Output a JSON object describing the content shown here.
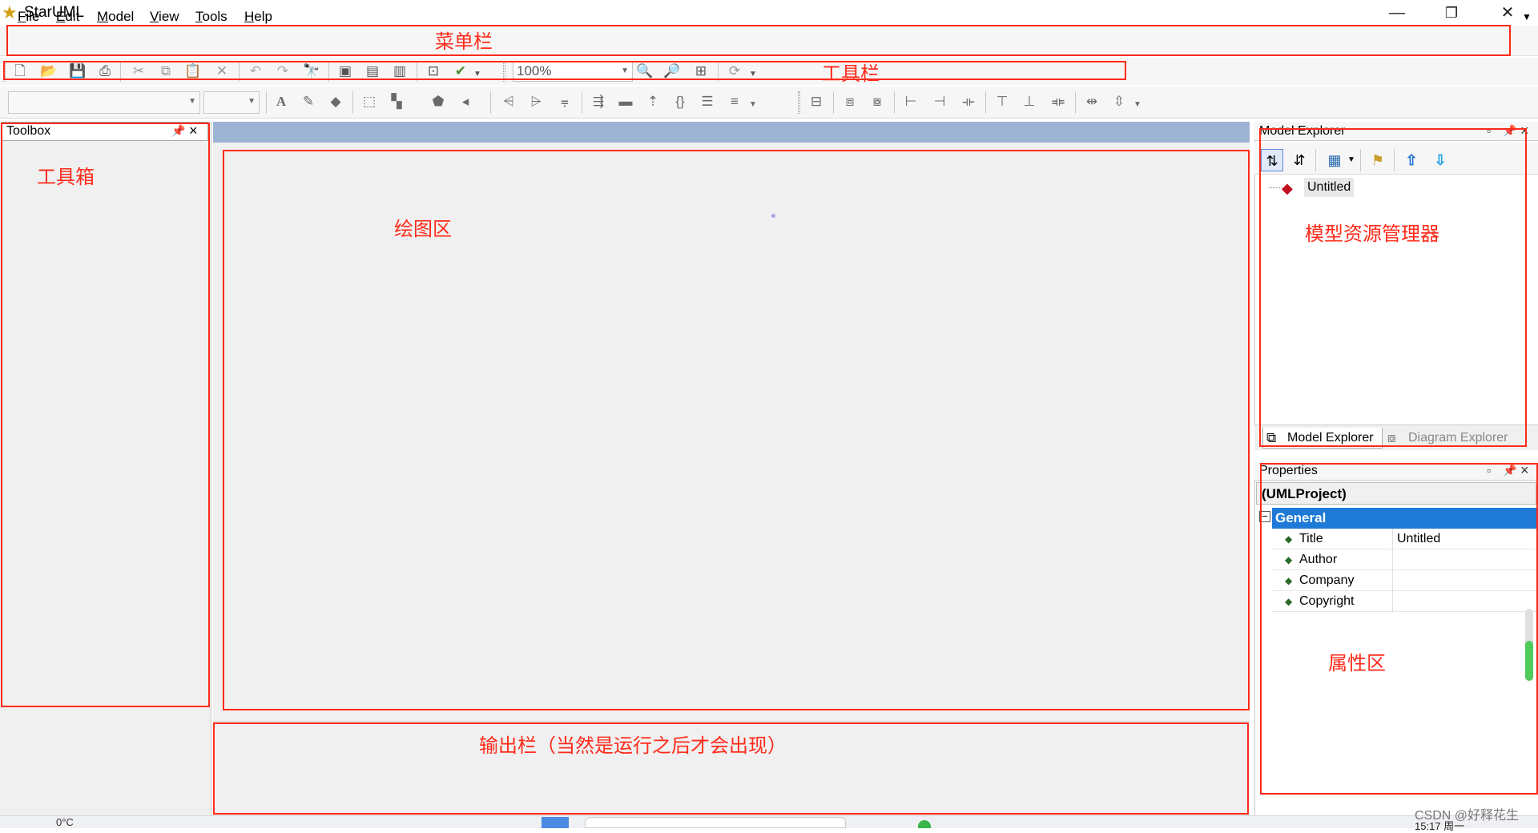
{
  "window": {
    "title": "StarUML"
  },
  "menu": [
    {
      "hot": "F",
      "rest": "ile"
    },
    {
      "hot": "E",
      "rest": "dit"
    },
    {
      "hot": "M",
      "rest": "odel"
    },
    {
      "hot": "V",
      "rest": "iew"
    },
    {
      "hot": "T",
      "rest": "ools"
    },
    {
      "hot": "H",
      "rest": "elp"
    }
  ],
  "toolbar": {
    "zoom": "100%"
  },
  "toolbox": {
    "title": "Toolbox"
  },
  "model_explorer": {
    "title": "Model Explorer",
    "root": "Untitled",
    "tabs": [
      "Model Explorer",
      "Diagram Explorer"
    ]
  },
  "properties": {
    "title": "Properties",
    "object": "(UMLProject)",
    "group": "General",
    "rows": [
      {
        "name": "Title",
        "value": "Untitled"
      },
      {
        "name": "Author",
        "value": ""
      },
      {
        "name": "Company",
        "value": ""
      },
      {
        "name": "Copyright",
        "value": ""
      }
    ]
  },
  "annotations": {
    "menubar": "菜单栏",
    "toolbar": "工具栏",
    "toolbox": "工具箱",
    "drawing": "绘图区",
    "explorer": "模型资源管理器",
    "properties": "属性区",
    "output": "输出栏（当然是运行之后才会出现）"
  },
  "taskbar": {
    "weather": "0°C",
    "watermark": "CSDN @好释花生",
    "clock": "15:17 周一"
  },
  "colors": {
    "annotation": "#ff2a1a",
    "selection": "#1e7ad6",
    "tabstrip": "#9db3d3"
  }
}
